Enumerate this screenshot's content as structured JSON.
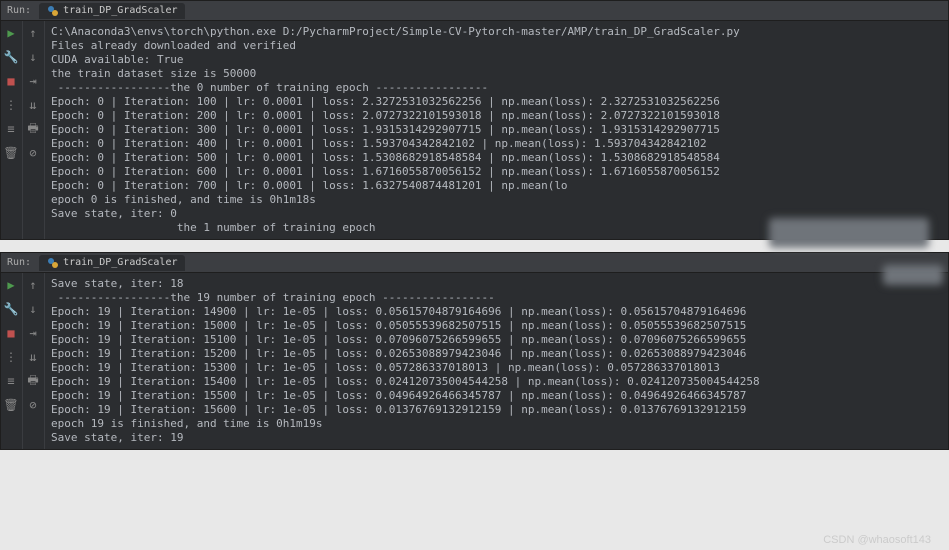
{
  "panel1": {
    "run_label": "Run:",
    "tab_label": "train_DP_GradScaler",
    "lines": [
      "C:\\Anaconda3\\envs\\torch\\python.exe D:/PycharmProject/Simple-CV-Pytorch-master/AMP/train_DP_GradScaler.py",
      "Files already downloaded and verified",
      "CUDA available: True",
      "the train dataset size is 50000",
      " -----------------the 0 number of training epoch -----------------",
      "Epoch: 0 | Iteration: 100 | lr: 0.0001 | loss: 2.3272531032562256 | np.mean(loss): 2.3272531032562256",
      "Epoch: 0 | Iteration: 200 | lr: 0.0001 | loss: 2.0727322101593018 | np.mean(loss): 2.0727322101593018",
      "Epoch: 0 | Iteration: 300 | lr: 0.0001 | loss: 1.9315314292907715 | np.mean(loss): 1.9315314292907715",
      "Epoch: 0 | Iteration: 400 | lr: 0.0001 | loss: 1.593704342842102 | np.mean(loss): 1.593704342842102",
      "Epoch: 0 | Iteration: 500 | lr: 0.0001 | loss: 1.5308682918548584 | np.mean(loss): 1.5308682918548584",
      "Epoch: 0 | Iteration: 600 | lr: 0.0001 | loss: 1.6716055870056152 | np.mean(loss): 1.6716055870056152",
      "Epoch: 0 | Iteration: 700 | lr: 0.0001 | loss: 1.6327540874481201 | np.mean(lo",
      "epoch 0 is finished, and time is 0h1m18s",
      "Save state, iter: 0",
      "                   the 1 number of training epoch"
    ]
  },
  "panel2": {
    "run_label": "Run:",
    "tab_label": "train_DP_GradScaler",
    "lines": [
      "",
      "Save state, iter: 18",
      " -----------------the 19 number of training epoch -----------------",
      "Epoch: 19 | Iteration: 14900 | lr: 1e-05 | loss: 0.05615704879164696 | np.mean(loss): 0.05615704879164696",
      "Epoch: 19 | Iteration: 15000 | lr: 1e-05 | loss: 0.05055539682507515 | np.mean(loss): 0.05055539682507515",
      "Epoch: 19 | Iteration: 15100 | lr: 1e-05 | loss: 0.07096075266599655 | np.mean(loss): 0.07096075266599655",
      "Epoch: 19 | Iteration: 15200 | lr: 1e-05 | loss: 0.02653088979423046 | np.mean(loss): 0.02653088979423046",
      "Epoch: 19 | Iteration: 15300 | lr: 1e-05 | loss: 0.057286337018013 | np.mean(loss): 0.057286337018013",
      "Epoch: 19 | Iteration: 15400 | lr: 1e-05 | loss: 0.024120735004544258 | np.mean(loss): 0.024120735004544258",
      "Epoch: 19 | Iteration: 15500 | lr: 1e-05 | loss: 0.04964926466345787 | np.mean(loss): 0.04964926466345787",
      "Epoch: 19 | Iteration: 15600 | lr: 1e-05 | loss: 0.01376769132912159 | np.mean(loss): 0.01376769132912159",
      "epoch 19 is finished, and time is 0h1m19s",
      "Save state, iter: 19"
    ]
  },
  "watermark": "CSDN @whaosoft143",
  "icons": {
    "play": "▶",
    "rerun": "↻",
    "stop": "■",
    "down": "↓",
    "wrench": "🔧",
    "wrap": "⇥",
    "print": "🖶",
    "delete": "🗑",
    "filter": "⋮",
    "separator": "≡"
  }
}
